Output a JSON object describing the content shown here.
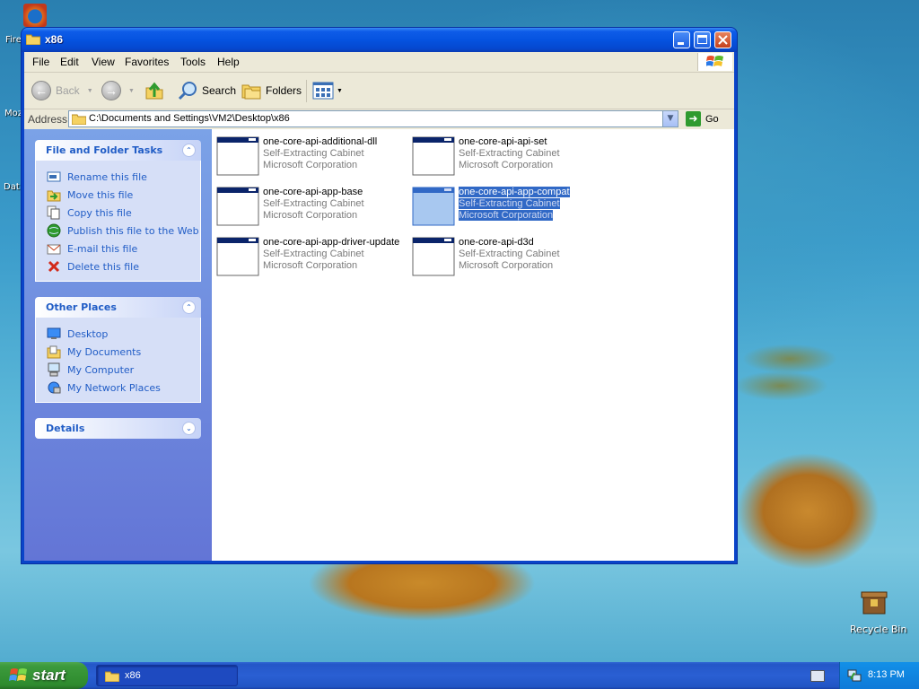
{
  "desktop": {
    "left_labels": [
      "Fire",
      "Moz",
      "Dat"
    ],
    "recycle_bin": "Recycle Bin"
  },
  "window": {
    "title": "x86",
    "menu": [
      "File",
      "Edit",
      "View",
      "Favorites",
      "Tools",
      "Help"
    ],
    "toolbar": {
      "back": "Back",
      "search": "Search",
      "folders": "Folders"
    },
    "address": {
      "label": "Address",
      "value": "C:\\Documents and Settings\\VM2\\Desktop\\x86",
      "go": "Go"
    }
  },
  "sidebar": {
    "file_tasks": {
      "title": "File and Folder Tasks",
      "items": [
        {
          "label": "Rename this file",
          "icon": "rename-icon"
        },
        {
          "label": "Move this file",
          "icon": "move-icon"
        },
        {
          "label": "Copy this file",
          "icon": "copy-icon"
        },
        {
          "label": "Publish this file to the Web",
          "icon": "web-icon"
        },
        {
          "label": "E-mail this file",
          "icon": "email-icon"
        },
        {
          "label": "Delete this file",
          "icon": "delete-icon"
        }
      ]
    },
    "other_places": {
      "title": "Other Places",
      "items": [
        {
          "label": "Desktop",
          "icon": "desktop-icon"
        },
        {
          "label": "My Documents",
          "icon": "my-documents-icon"
        },
        {
          "label": "My Computer",
          "icon": "my-computer-icon"
        },
        {
          "label": "My Network Places",
          "icon": "network-icon"
        }
      ]
    },
    "details": {
      "title": "Details"
    }
  },
  "files": [
    {
      "name": "one-core-api-additional-dll",
      "type": "Self-Extracting Cabinet",
      "company": "Microsoft Corporation",
      "selected": false
    },
    {
      "name": "one-core-api-api-set",
      "type": "Self-Extracting Cabinet",
      "company": "Microsoft Corporation",
      "selected": false
    },
    {
      "name": "one-core-api-app-base",
      "type": "Self-Extracting Cabinet",
      "company": "Microsoft Corporation",
      "selected": false
    },
    {
      "name": "one-core-api-app-compat",
      "type": "Self-Extracting Cabinet",
      "company": "Microsoft Corporation",
      "selected": true
    },
    {
      "name": "one-core-api-app-driver-update",
      "type": "Self-Extracting Cabinet",
      "company": "Microsoft Corporation",
      "selected": false
    },
    {
      "name": "one-core-api-d3d",
      "type": "Self-Extracting Cabinet",
      "company": "Microsoft Corporation",
      "selected": false
    }
  ],
  "taskbar": {
    "start": "start",
    "task": "x86",
    "clock": "8:13 PM"
  },
  "colors": {
    "title_blue": "#0553e0",
    "link_blue": "#215dc6",
    "selection": "#3169c6",
    "start_green": "#2e8b2e"
  }
}
